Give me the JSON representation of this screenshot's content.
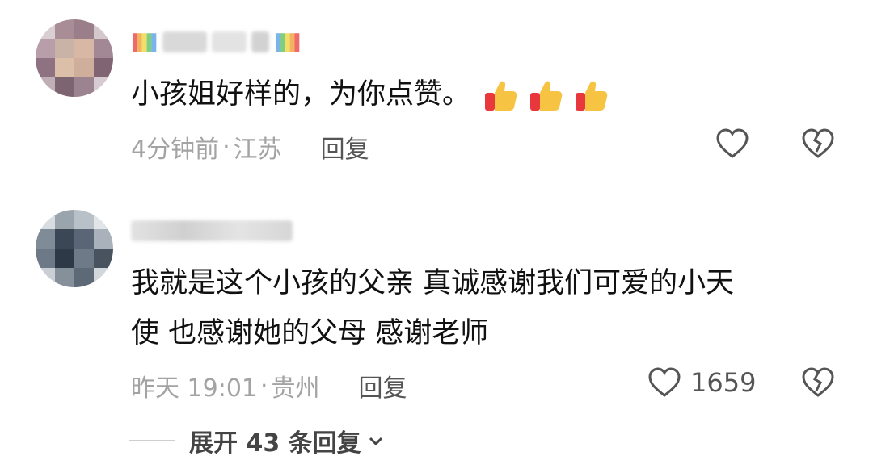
{
  "comments": [
    {
      "text": "小孩姐好样的，为你点赞。",
      "emoji": [
        "thumbs-up",
        "thumbs-up",
        "thumbs-up"
      ],
      "time": "4分钟前",
      "location": "江苏",
      "reply_label": "回复",
      "like_count": "",
      "username_style": "rainbow-blurred"
    },
    {
      "text_line1": "我就是这个小孩的父亲 真诚感谢我们可爱的小天",
      "text_line2": "使 也感谢她的父母 感谢老师",
      "time": "昨天 19:01",
      "location": "贵州",
      "reply_label": "回复",
      "like_count": "1659",
      "username_style": "blurred"
    }
  ],
  "separator": "·",
  "expand_label": "展开 43 条回复",
  "colors": {
    "meta": "#a3a3a3",
    "text": "#111111",
    "icon": "#555555"
  }
}
